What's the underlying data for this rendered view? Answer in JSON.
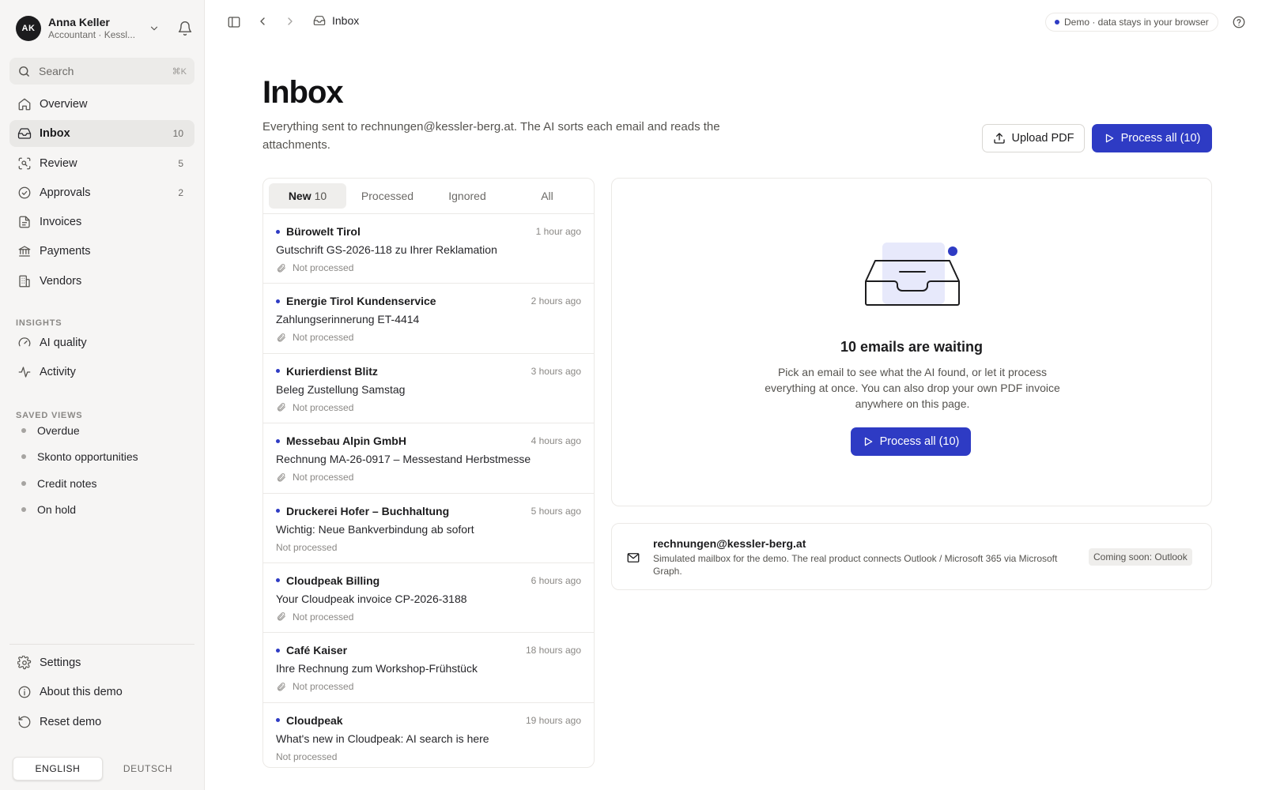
{
  "user": {
    "initials": "AK",
    "name": "Anna Keller",
    "role": "Accountant · Kessl..."
  },
  "search": {
    "label": "Search",
    "shortcut": "⌘K"
  },
  "nav": [
    {
      "label": "Overview",
      "icon": "home-icon",
      "count": ""
    },
    {
      "label": "Inbox",
      "icon": "inbox-icon",
      "count": "10",
      "active": true
    },
    {
      "label": "Review",
      "icon": "scan-icon",
      "count": "5"
    },
    {
      "label": "Approvals",
      "icon": "check-circle-icon",
      "count": "2"
    },
    {
      "label": "Invoices",
      "icon": "file-icon",
      "count": ""
    },
    {
      "label": "Payments",
      "icon": "bank-icon",
      "count": ""
    },
    {
      "label": "Vendors",
      "icon": "building-icon",
      "count": ""
    }
  ],
  "insights": {
    "heading": "INSIGHTS",
    "items": [
      {
        "label": "AI quality",
        "icon": "gauge-icon"
      },
      {
        "label": "Activity",
        "icon": "activity-icon"
      }
    ]
  },
  "saved_views": {
    "heading": "SAVED VIEWS",
    "items": [
      "Overdue",
      "Skonto opportunities",
      "Credit notes",
      "On hold"
    ]
  },
  "bottom_nav": [
    {
      "label": "Settings",
      "icon": "gear-icon"
    },
    {
      "label": "About this demo",
      "icon": "info-icon"
    },
    {
      "label": "Reset demo",
      "icon": "reset-icon"
    }
  ],
  "language": {
    "english": "ENGLISH",
    "deutsch": "DEUTSCH",
    "selected": "ENGLISH"
  },
  "topbar": {
    "breadcrumb": "Inbox",
    "demo_notice": "Demo · data stays in your browser"
  },
  "header": {
    "title": "Inbox",
    "subtitle": "Everything sent to rechnungen@kessler-berg.at. The AI sorts each email and reads the attachments.",
    "upload_label": "Upload PDF",
    "process_all_label": "Process all (10)"
  },
  "tabs": [
    {
      "label": "New",
      "count": "10",
      "active": true
    },
    {
      "label": "Processed",
      "count": ""
    },
    {
      "label": "Ignored",
      "count": ""
    },
    {
      "label": "All",
      "count": ""
    }
  ],
  "emails": [
    {
      "sender": "Bürowelt Tirol",
      "time": "1 hour ago",
      "subject": "Gutschrift GS-2026-118 zu Ihrer Reklamation",
      "status": "Not processed",
      "attachment": true
    },
    {
      "sender": "Energie Tirol Kundenservice",
      "time": "2 hours ago",
      "subject": "Zahlungserinnerung ET-4414",
      "status": "Not processed",
      "attachment": true
    },
    {
      "sender": "Kurierdienst Blitz",
      "time": "3 hours ago",
      "subject": "Beleg Zustellung Samstag",
      "status": "Not processed",
      "attachment": true
    },
    {
      "sender": "Messebau Alpin GmbH",
      "time": "4 hours ago",
      "subject": "Rechnung MA-26-0917 – Messestand Herbstmesse",
      "status": "Not processed",
      "attachment": true
    },
    {
      "sender": "Druckerei Hofer – Buchhaltung",
      "time": "5 hours ago",
      "subject": "Wichtig: Neue Bankverbindung ab sofort",
      "status": "Not processed",
      "attachment": false
    },
    {
      "sender": "Cloudpeak Billing",
      "time": "6 hours ago",
      "subject": "Your Cloudpeak invoice CP-2026-3188",
      "status": "Not processed",
      "attachment": true
    },
    {
      "sender": "Café Kaiser",
      "time": "18 hours ago",
      "subject": "Ihre Rechnung zum Workshop-Frühstück",
      "status": "Not processed",
      "attachment": true
    },
    {
      "sender": "Cloudpeak",
      "time": "19 hours ago",
      "subject": "What's new in Cloudpeak: AI search is here",
      "status": "Not processed",
      "attachment": false
    }
  ],
  "empty_state": {
    "title": "10 emails are waiting",
    "description": "Pick an email to see what the AI found, or let it process everything at once. You can also drop your own PDF invoice anywhere on this page.",
    "button_label": "Process all (10)"
  },
  "mailbox": {
    "address": "rechnungen@kessler-berg.at",
    "note": "Simulated mailbox for the demo. The real product connects Outlook / Microsoft 365 via Microsoft Graph.",
    "badge": "Coming soon: Outlook"
  },
  "colors": {
    "accent": "#2e3bc4",
    "sidebar_bg": "#f6f5f4",
    "border": "#ebe9e6",
    "text": "#1c1c1e"
  }
}
